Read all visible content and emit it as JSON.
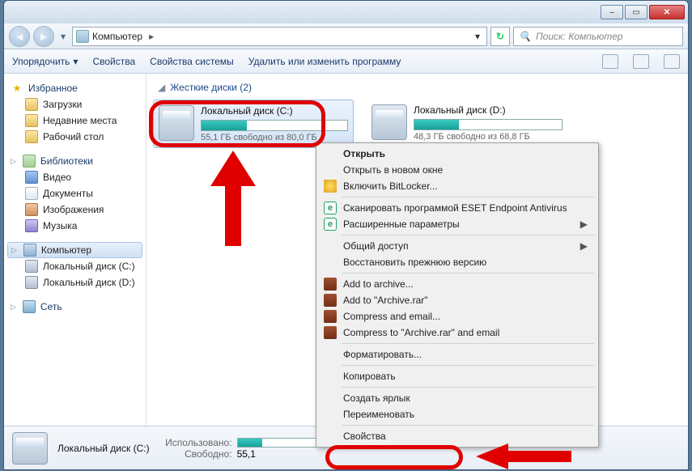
{
  "window": {
    "min": "–",
    "max": "▭",
    "close": "✕"
  },
  "nav": {
    "address_icon": "computer",
    "address": "Компьютер",
    "search_placeholder": "Поиск: Компьютер"
  },
  "toolbar": {
    "organize": "Упорядочить",
    "properties": "Свойства",
    "sysprops": "Свойства системы",
    "uninstall": "Удалить или изменить программу"
  },
  "sidebar": {
    "favorites": {
      "label": "Избранное",
      "items": [
        "Загрузки",
        "Недавние места",
        "Рабочий стол"
      ]
    },
    "libraries": {
      "label": "Библиотеки",
      "items": [
        "Видео",
        "Документы",
        "Изображения",
        "Музыка"
      ]
    },
    "computer": {
      "label": "Компьютер",
      "items": [
        "Локальный диск (C:)",
        "Локальный диск (D:)"
      ]
    },
    "network": {
      "label": "Сеть"
    }
  },
  "content": {
    "group_label": "Жесткие диски (2)",
    "disks": [
      {
        "name": "Локальный диск (C:)",
        "free_text": "55,1 ГБ свободно из 80,0 ГБ",
        "fill_pct": 31
      },
      {
        "name": "Локальный диск (D:)",
        "free_text": "48,3 ГБ свободно из 68,8 ГБ",
        "fill_pct": 30
      }
    ]
  },
  "details": {
    "name": "Локальный диск (C:)",
    "used_label": "Использовано:",
    "free_label": "Свободно:",
    "free_value": "55,1",
    "used_fill_pct": 31
  },
  "context_menu": {
    "items": [
      {
        "label": "Открыть",
        "bold": true
      },
      {
        "label": "Открыть в новом окне"
      },
      {
        "label": "Включить BitLocker...",
        "icon": "shield"
      },
      {
        "sep": true
      },
      {
        "label": "Сканировать программой ESET Endpoint Antivirus",
        "icon": "eset"
      },
      {
        "label": "Расширенные параметры",
        "icon": "eset",
        "submenu": true
      },
      {
        "sep": true
      },
      {
        "label": "Общий доступ",
        "submenu": true
      },
      {
        "label": "Восстановить прежнюю версию"
      },
      {
        "sep": true
      },
      {
        "label": "Add to archive...",
        "icon": "rar"
      },
      {
        "label": "Add to \"Archive.rar\"",
        "icon": "rar"
      },
      {
        "label": "Compress and email...",
        "icon": "rar"
      },
      {
        "label": "Compress to \"Archive.rar\" and email",
        "icon": "rar"
      },
      {
        "sep": true
      },
      {
        "label": "Форматировать..."
      },
      {
        "sep": true
      },
      {
        "label": "Копировать"
      },
      {
        "sep": true
      },
      {
        "label": "Создать ярлык"
      },
      {
        "label": "Переименовать"
      },
      {
        "sep": true
      },
      {
        "label": "Свойства"
      }
    ]
  }
}
